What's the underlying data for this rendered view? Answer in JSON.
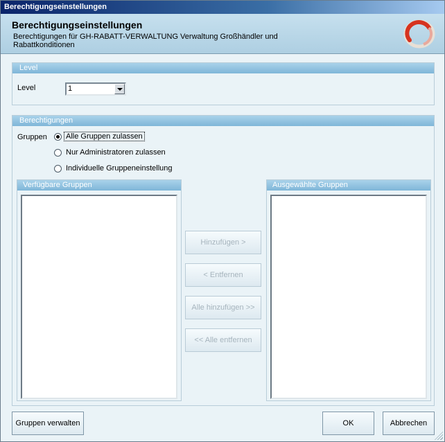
{
  "window": {
    "title": "Berechtigungseinstellungen"
  },
  "header": {
    "title": "Berechtigungseinstellungen",
    "subtitle": "Berechtigungen für GH-RABATT-VERWALTUNG Verwaltung Großhändler und Rabattkonditionen",
    "logo_icon": "oracle-ring-logo-icon"
  },
  "level_panel": {
    "heading": "Level",
    "label": "Level",
    "selected_value": "1"
  },
  "permissions_panel": {
    "heading": "Berechtigungen",
    "groups_label": "Gruppen",
    "options": [
      {
        "label": "Alle Gruppen zulassen",
        "checked": true
      },
      {
        "label": "Nur Administratoren zulassen",
        "checked": false
      },
      {
        "label": "Individuelle Gruppeneinstellung",
        "checked": false
      }
    ],
    "available_groups": {
      "heading": "Verfügbare Gruppen",
      "items": []
    },
    "selected_groups": {
      "heading": "Ausgewählte Gruppen",
      "items": []
    },
    "buttons": {
      "add": "Hinzufügen >",
      "remove": "< Entfernen",
      "add_all": "Alle hinzufügen >>",
      "remove_all": "<< Alle entfernen"
    }
  },
  "footer": {
    "manage_groups": "Gruppen verwalten",
    "ok": "OK",
    "cancel": "Abbrechen"
  },
  "colors": {
    "titlebar": "#0a246a",
    "header_bg": "#aecfe2",
    "panel_bg": "#eaf3f7",
    "panel_head": "#7fb6d8",
    "logo_red": "#d6331f"
  }
}
